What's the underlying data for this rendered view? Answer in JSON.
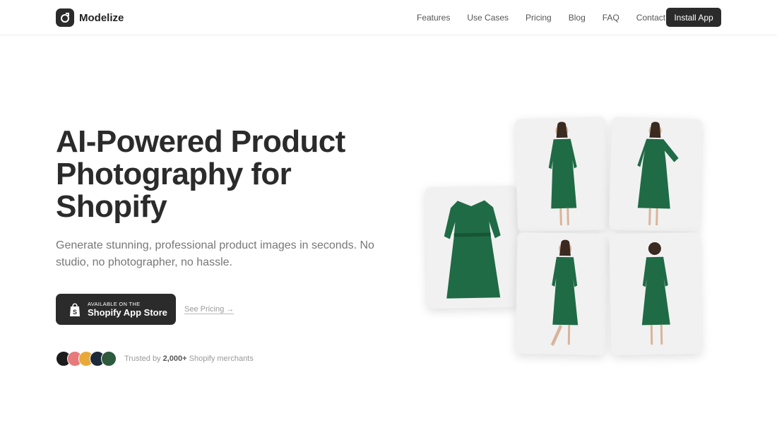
{
  "brand": {
    "name": "Modelize"
  },
  "nav": {
    "links": [
      "Features",
      "Use Cases",
      "Pricing",
      "Blog",
      "FAQ",
      "Contact"
    ],
    "cta": "Install App"
  },
  "hero": {
    "title": "AI-Powered Product Photography for Shopify",
    "subtitle": "Generate stunning, professional product images in seconds. No studio, no photographer, no hassle.",
    "store_small": "AVAILABLE ON THE",
    "store_big": "Shopify App Store",
    "see_pricing": "See Pricing →"
  },
  "trust": {
    "prefix": "Trusted by",
    "count": "2,000+",
    "suffix": "Shopify merchants",
    "avatar_colors": [
      "#1c1c1c",
      "#e77a7a",
      "#e9a93a",
      "#1d2a3a",
      "#2e5a3e"
    ]
  },
  "colors": {
    "dress": "#1f6b45",
    "dark": "#2b2b2b"
  }
}
